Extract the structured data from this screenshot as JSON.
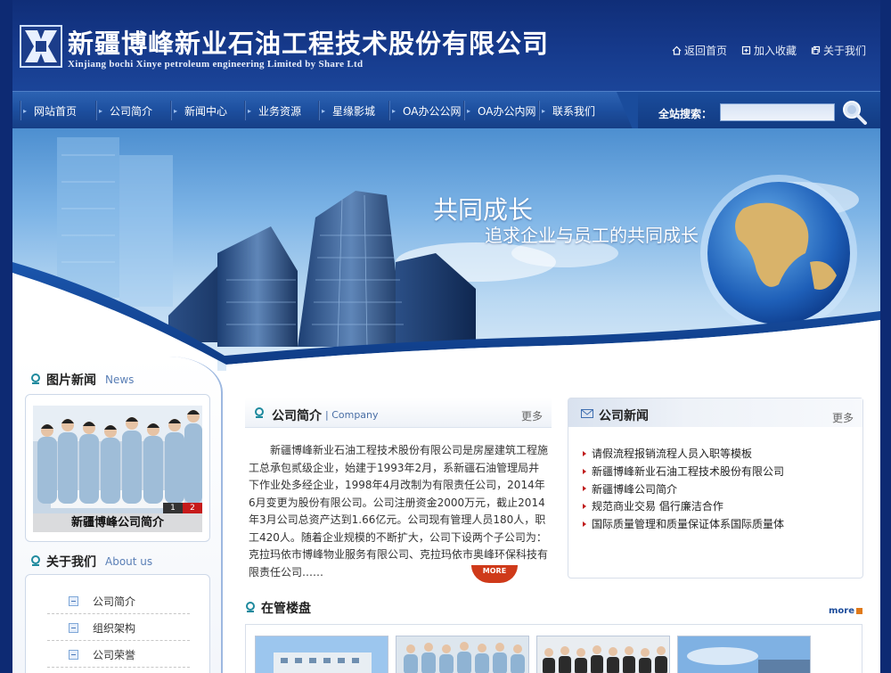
{
  "header": {
    "brand_cn": "新疆博峰新业石油工程技术股份有限公司",
    "brand_en": "Xinjiang bochi Xinye petroleum engineering Limited by Share Ltd",
    "links": [
      {
        "label": "返回首页",
        "icon": "home-icon"
      },
      {
        "label": "加入收藏",
        "icon": "favorite-icon"
      },
      {
        "label": "关于我们",
        "icon": "info-icon"
      }
    ]
  },
  "nav": {
    "items": [
      "网站首页",
      "公司简介",
      "新闻中心",
      "业务资源",
      "星缘影城",
      "OA办公公网",
      "OA办公内网",
      "联系我们"
    ],
    "search_label": "全站搜索：",
    "search_value": ""
  },
  "banner": {
    "slogan_main": "共同成长",
    "slogan_sub": "追求企业与员工的共同成长"
  },
  "sidebar": {
    "pic_news": {
      "title": "图片新闻",
      "title_en": "News",
      "caption": "新疆博峰公司简介",
      "pages": [
        "1",
        "2"
      ],
      "active_page": 2
    },
    "about": {
      "title": "关于我们",
      "title_en": "About us",
      "items": [
        "公司简介",
        "组织架构",
        "公司荣誉"
      ]
    }
  },
  "intro": {
    "title": "公司简介",
    "title_en": "Company",
    "more": "更多",
    "text": "新疆博峰新业石油工程技术股份有限公司是房屋建筑工程施工总承包贰级企业，始建于1993年2月，系新疆石油管理局井下作业处多经企业，1998年4月改制为有限责任公司，2014年6月变更为股份有限公司。公司注册资金2000万元，截止2014年3月公司总资产达到1.66亿元。公司现有管理人员180人，职工420人。随着企业规模的不断扩大，公司下设两个子公司为：克拉玛依市博峰物业服务有限公司、克拉玛依市奥峰环保科技有限责任公司……",
    "more_tag": "MORE"
  },
  "news": {
    "title": "公司新闻",
    "more": "更多",
    "items": [
      "请假流程报销流程人员入职等模板",
      "新疆博峰新业石油工程技术股份有限公司",
      "新疆博峰公司简介",
      "规范商业交易 倡行廉洁合作",
      "国际质量管理和质量保证体系国际质量体"
    ]
  },
  "buildings": {
    "title": "在管楼盘",
    "more": "more"
  },
  "colors": {
    "page_bg": "#0d2a73",
    "nav_bg": "#1d4f9f",
    "accent_red": "#c61a1a",
    "link_blue": "#4a6fa6"
  }
}
